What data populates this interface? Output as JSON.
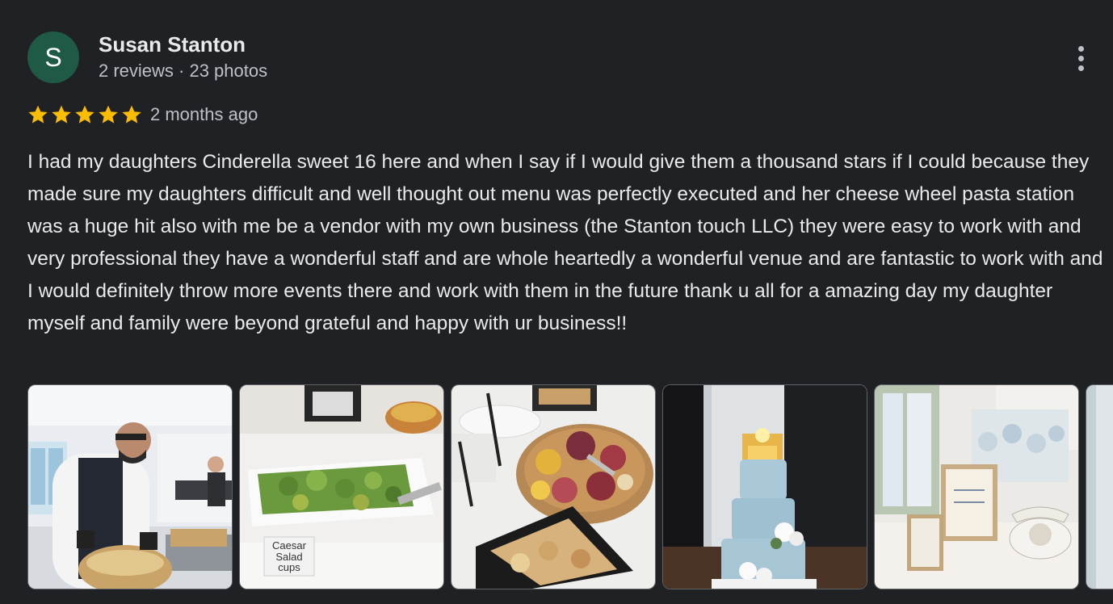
{
  "reviewer": {
    "initial": "S",
    "name": "Susan Stanton",
    "stats": "2 reviews · 23 photos",
    "avatar_color": "#1e5a45"
  },
  "review": {
    "rating": 5,
    "star_color": "#fbbc04",
    "time_ago": "2 months ago",
    "text": "I had my daughters Cinderella sweet 16 here and when I say if I would give them a thousand stars if I could because they made sure my daughters difficult and well thought out menu was perfectly executed and her cheese wheel pasta station was a huge hit also with me be a vendor with my own business (the Stanton touch LLC) they were easy to work with and very professional they have a wonderful staff and are whole heartedly a wonderful venue and are fantastic to work with and I would definitely throw more events there and work with them in the future thank u all for a amazing day my daughter myself and family were beyond grateful and happy with ur business!!"
  },
  "photos": [
    {
      "subject": "chef at cheese wheel pasta station"
    },
    {
      "subject": "salad tray",
      "sign_lines": [
        "Caesar",
        "Salad",
        "cups"
      ]
    },
    {
      "subject": "charcuterie board and crackers"
    },
    {
      "subject": "three-tier blue cake with castle topper"
    },
    {
      "subject": "framed signs and telephone"
    },
    {
      "subject": "partial photo"
    }
  ],
  "icons": {
    "more": "more-vert-icon",
    "star": "star-icon"
  }
}
